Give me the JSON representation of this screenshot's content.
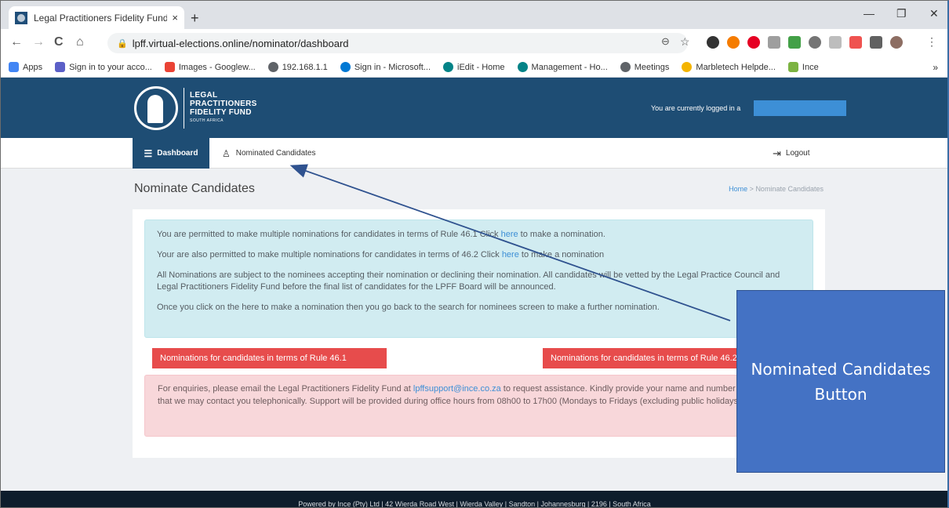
{
  "browser": {
    "tab_title": "Legal Practitioners Fidelity Fund",
    "tab_close": "×",
    "new_tab": "+",
    "url": "lpff.virtual-elections.online/nominator/dashboard",
    "window_controls": {
      "minimize": "—",
      "restore": "❐",
      "close": "✕"
    },
    "nav_icons": {
      "back": "←",
      "forward": "→",
      "reload": "C",
      "home": "⌂"
    },
    "bookmarks": [
      {
        "label": "Apps",
        "color": "#4285f4"
      },
      {
        "label": "Sign in to your acco...",
        "color": "#5b5fc7"
      },
      {
        "label": "Images - Googlew...",
        "color": "#ea4335"
      },
      {
        "label": "192.168.1.1",
        "color": "#5f6368"
      },
      {
        "label": "Sign in - Microsoft...",
        "color": "#0078d4"
      },
      {
        "label": "iEdit - Home",
        "color": "#038387"
      },
      {
        "label": "Management - Ho...",
        "color": "#038387"
      },
      {
        "label": "Meetings",
        "color": "#5f6368"
      },
      {
        "label": "Marbletech Helpde...",
        "color": "#f4b400"
      },
      {
        "label": "Ince",
        "color": "#7cb342"
      }
    ],
    "bookmarks_more": "»"
  },
  "site": {
    "logo_lines": [
      "LEGAL",
      "PRACTITIONERS",
      "FIDELITY FUND"
    ],
    "logo_sub": "SOUTH AFRICA",
    "logged_in_text": "You are currently logged in a",
    "nav": {
      "dashboard": "Dashboard",
      "nominated_candidates": "Nominated Candidates",
      "logout": "Logout"
    }
  },
  "page": {
    "title": "Nominate Candidates",
    "breadcrumb": {
      "home": "Home",
      "sep": ">",
      "current": "Nominate Candidates"
    },
    "info": {
      "p1_pre": "You are permitted to make multiple nominations for candidates in terms of Rule 46.1 Click ",
      "p1_link": "here",
      "p1_post": " to make a nomination.",
      "p2_pre": "Your are also permitted to make multiple nominations for candidates in terms of 46.2 Click ",
      "p2_link": "here",
      "p2_post": " to make a nomination",
      "p3": "All Nominations are subject to the nominees accepting their nomination or declining their nomination. All candidates will be vetted by the Legal Practice Council and Legal Practitioners Fidelity Fund before the final list of candidates for the LPFF Board will be announced.",
      "p4": "Once you click on the here to make a nomination then you go back to the search for nominees screen to make a further nomination."
    },
    "buttons": {
      "rule461": "Nominations for candidates in terms of Rule 46.1",
      "rule462": "Nominations for candidates in terms of Rule 46.2"
    },
    "alert": {
      "pre": "For enquiries, please email the Legal Practitioners Fidelity Fund at ",
      "email": "lpffsupport@ince.co.za",
      "post": " to request assistance. Kindly provide your name and number in your email so that we may contact you telephonically. Support will be provided during office hours from 08h00 to 17h00 (Mondays to Fridays (excluding public holidays))"
    },
    "footer": "Powered by Ince (Pty) Ltd | 42 Wierda Road West | Wierda Valley | Sandton | Johannesburg | 2196 | South Africa"
  },
  "annotation": {
    "label": "Nominated Candidates Button"
  },
  "colors": {
    "brand_blue": "#1e4d74",
    "info_bg": "#d1ecf1",
    "danger_btn": "#e74c4c",
    "alert_bg": "#f8d7da",
    "callout": "#4472c4"
  }
}
